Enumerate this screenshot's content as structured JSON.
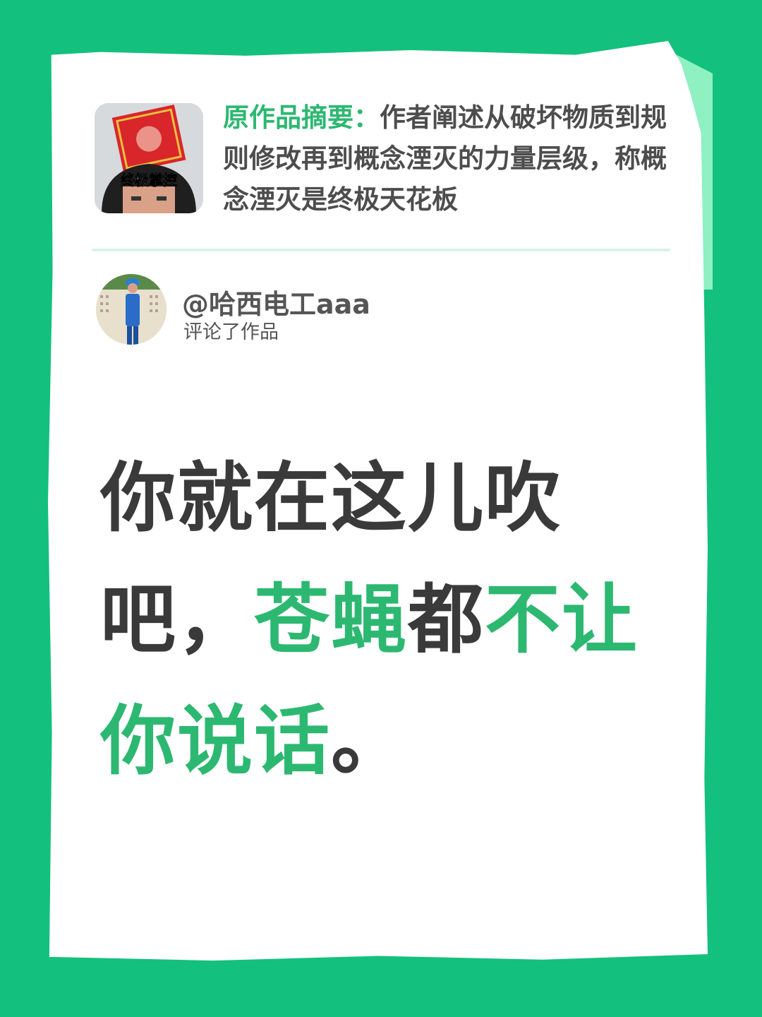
{
  "summary": {
    "label": "原作品摘要：",
    "text": "作者阐述从破坏物质到规则修改再到概念湮灭的力量层级，称概念湮灭是终极天花板",
    "thumbnail_caption": "终极掌控"
  },
  "comment": {
    "username": "@哈西电工aaa",
    "action": "评论了作品",
    "lines": [
      [
        {
          "text": "你就在这儿吹",
          "highlight": false
        }
      ],
      [
        {
          "text": "吧，",
          "highlight": false
        },
        {
          "text": "苍蝇",
          "highlight": true
        },
        {
          "text": "都",
          "highlight": false
        },
        {
          "text": "不让",
          "highlight": true
        }
      ],
      [
        {
          "text": "你说话",
          "highlight": true
        },
        {
          "text": "。",
          "highlight": false
        }
      ]
    ]
  },
  "colors": {
    "background": "#14c07e",
    "accent": "#2db872",
    "text": "#3a3a3a"
  }
}
